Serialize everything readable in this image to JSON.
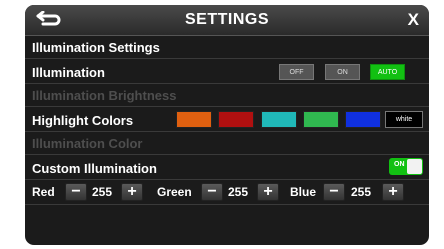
{
  "header": {
    "title": "SETTINGS",
    "close_label": "X",
    "back_icon": "back-arrow-icon"
  },
  "section_title": "Illumination Settings",
  "illumination": {
    "label": "Illumination",
    "options": [
      "OFF",
      "ON",
      "AUTO"
    ],
    "selected": "AUTO",
    "active_color": "#12c012"
  },
  "brightness": {
    "label": "Illumination Brightness",
    "enabled": false
  },
  "highlight": {
    "label": "Highlight Colors",
    "swatches": [
      "#e06010",
      "#b01010",
      "#20b8b8",
      "#30b850",
      "#1030e0"
    ],
    "white_label": "white"
  },
  "illum_color": {
    "label": "Illumination Color",
    "enabled": false
  },
  "custom": {
    "label": "Custom Illumination",
    "toggle_label": "ON",
    "state": true
  },
  "rgb": {
    "red_label": "Red",
    "red_value": "255",
    "green_label": "Green",
    "green_value": "255",
    "blue_label": "Blue",
    "blue_value": "255",
    "minus": "−",
    "plus": "+"
  }
}
